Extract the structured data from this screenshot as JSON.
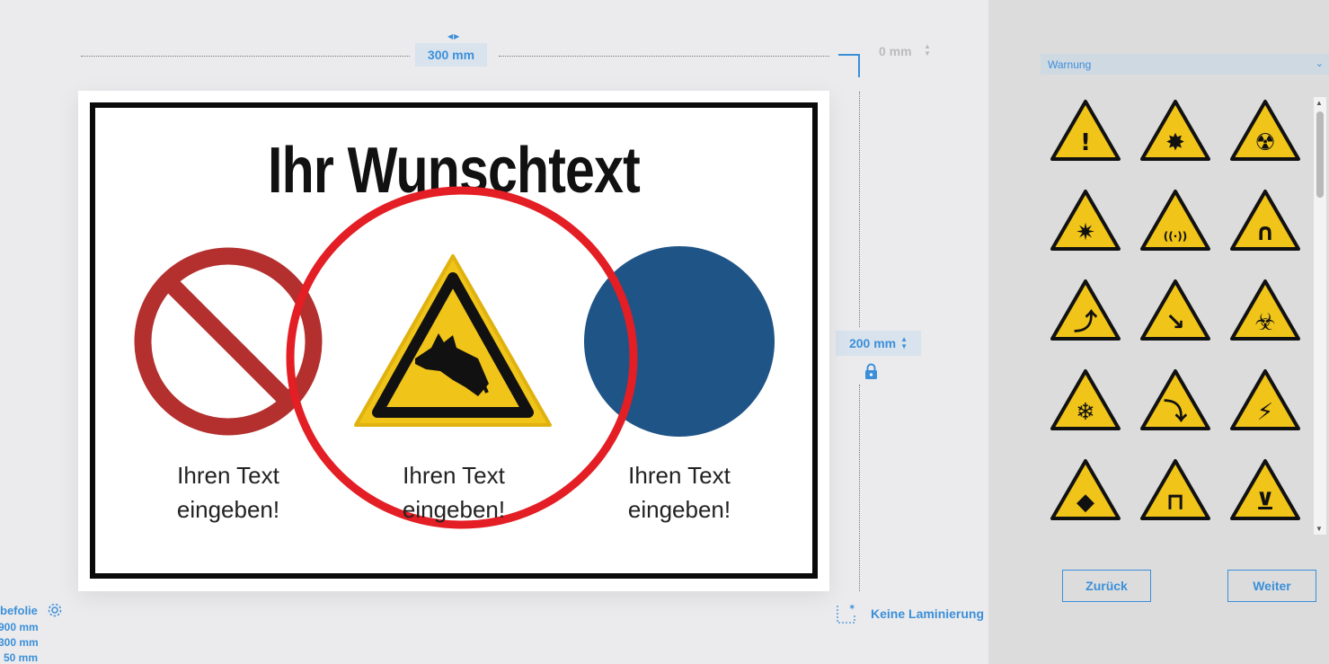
{
  "editor": {
    "width_value": "300 mm",
    "height_value": "200 mm",
    "corner_radius": "0 mm",
    "lamination_label": "Keine Laminierung"
  },
  "sign": {
    "title": "Ihr Wunschtext",
    "captions": [
      {
        "line1": "Ihren Text",
        "line2": "eingeben!"
      },
      {
        "line1": "Ihren Text",
        "line2": "eingeben!"
      },
      {
        "line1": "Ihren Text",
        "line2": "eingeben!"
      }
    ],
    "symbols": [
      "prohibition-icon",
      "guard-dog-warning-icon",
      "mandatory-blue-circle-icon"
    ],
    "colors": {
      "prohibition_red": "#b3302f",
      "warning_yellow": "#f0c419",
      "mandatory_blue": "#1f5486",
      "highlight_red": "#e31e24"
    }
  },
  "material": {
    "label": "befolie",
    "specs": [
      "900 mm",
      "300 mm",
      "50 mm"
    ]
  },
  "panel": {
    "category_selected": "Warnung",
    "symbols": [
      "general-warning-icon",
      "explosive-icon",
      "radiation-icon",
      "laser-icon",
      "non-ionizing-radiation-icon",
      "magnetic-field-icon",
      "obstacle-floor-icon",
      "fall-hazard-icon",
      "biohazard-icon",
      "low-temperature-icon",
      "slippery-surface-icon",
      "electricity-icon",
      "guard-dog-icon",
      "forklift-icon",
      "suspended-load-icon"
    ],
    "back_label": "Zurück",
    "next_label": "Weiter"
  },
  "accent_color": "#3b8fd9"
}
